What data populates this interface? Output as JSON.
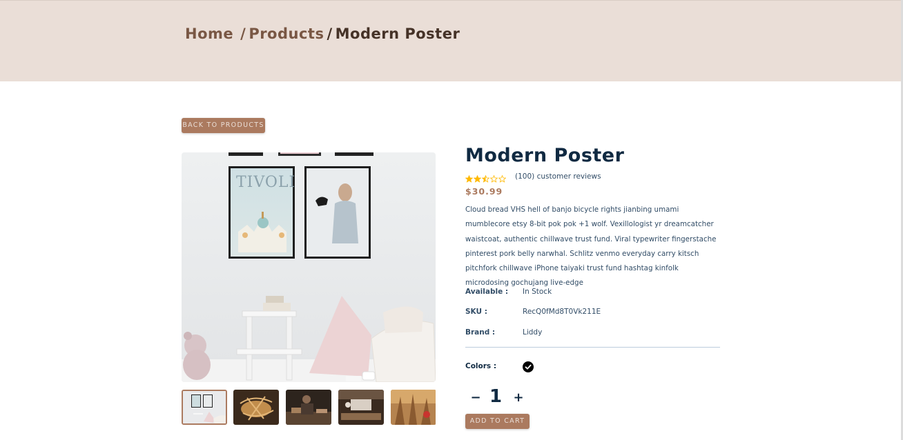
{
  "breadcrumb": {
    "home": "Home",
    "separator": "/",
    "products": "Products",
    "current": "Modern Poster"
  },
  "back_button": "BACK TO PRODUCTS",
  "product": {
    "name": "Modern Poster",
    "rating": 2.5,
    "rating_max": 5,
    "reviews": "(100) customer reviews",
    "price": "$30.99",
    "description": "Cloud bread VHS hell of banjo bicycle rights jianbing umami mumblecore etsy 8-bit pok pok +1 wolf. Vexillologist yr dreamcatcher waistcoat, authentic chillwave trust fund. Viral typewriter fingerstache pinterest pork belly narwhal. Schlitz venmo everyday carry kitsch pitchfork chillwave iPhone taiyaki trust fund hashtag kinfolk microdosing gochujang live-edge",
    "available_label": "Available :",
    "available_value": "In Stock",
    "sku_label": "SKU :",
    "sku_value": "RecQ0fMd8T0Vk211E",
    "brand_label": "Brand :",
    "brand_value": "Liddy",
    "colors_label": "Colors :",
    "colors": [
      "#000000"
    ],
    "quantity": "1",
    "decrease": "−",
    "increase": "+",
    "add_to_cart": "ADD TO CART"
  },
  "theme": {
    "accent": "#ab7a5f",
    "hero_bg": "#eaded7",
    "heading": "#102a42",
    "star": "#ffb900"
  }
}
